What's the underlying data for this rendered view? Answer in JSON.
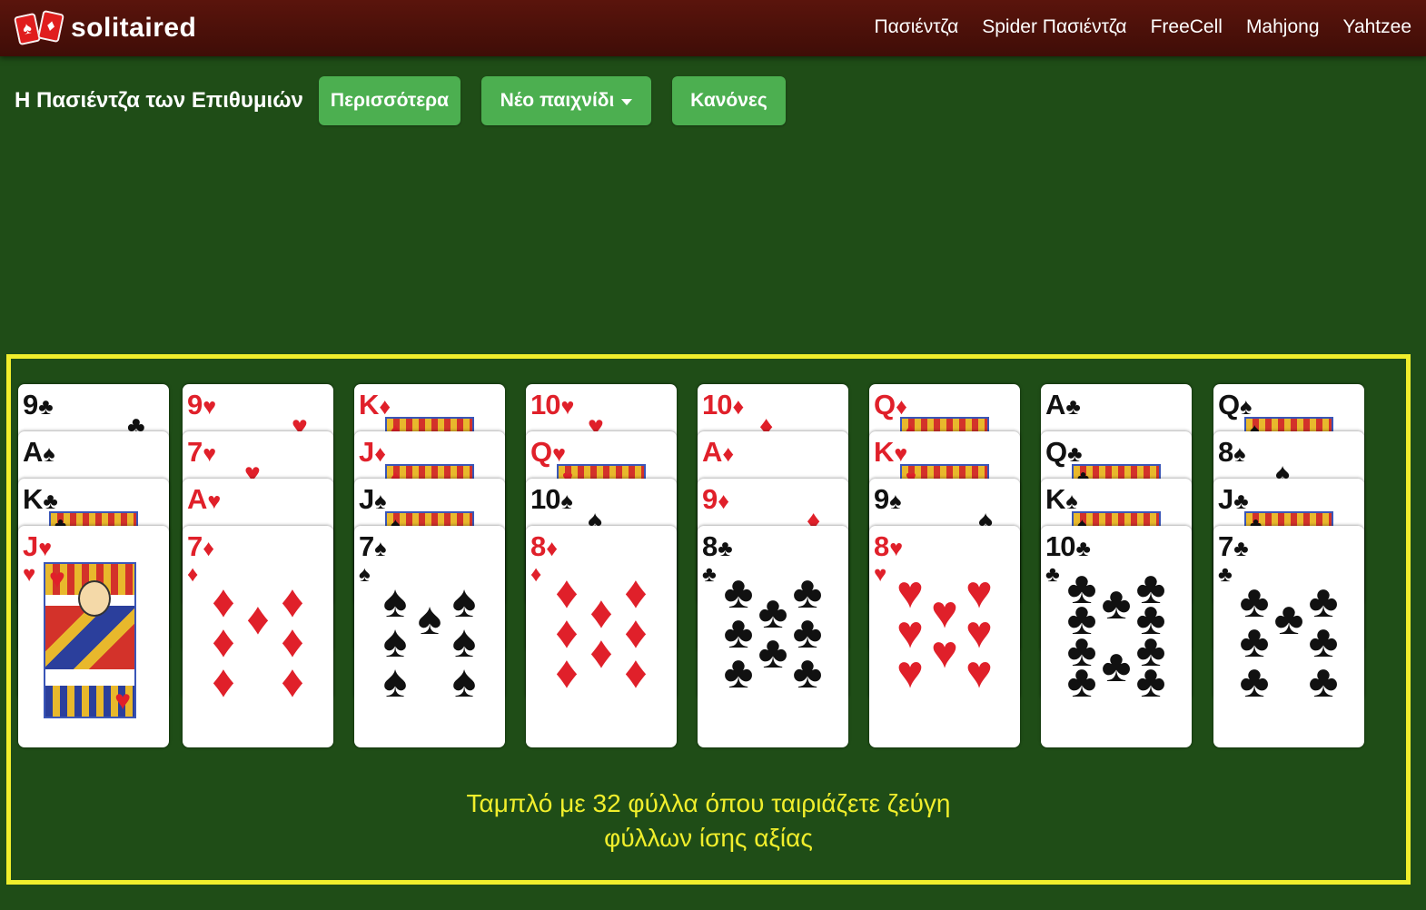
{
  "brand": {
    "name": "solitaired"
  },
  "nav": [
    {
      "label": "Πασιέντζα"
    },
    {
      "label": "Spider Πασιέντζα"
    },
    {
      "label": "FreeCell"
    },
    {
      "label": "Mahjong"
    },
    {
      "label": "Yahtzee"
    }
  ],
  "page": {
    "title": "Η Πασιέντζα των Επιθυμιών"
  },
  "toolbar": {
    "more_label": "Περισσότερα",
    "new_game_label": "Νέο παιχνίδι",
    "rules_label": "Κανόνες"
  },
  "colors": {
    "felt": "#1f4d17",
    "topbar": "#4a100a",
    "button": "#4caf50",
    "highlight": "#f0ee2c",
    "red_suit": "#e0202a"
  },
  "tableau": [
    {
      "cards": [
        {
          "rank": "9",
          "suit": "♣"
        },
        {
          "rank": "A",
          "suit": "♠"
        },
        {
          "rank": "K",
          "suit": "♣"
        },
        {
          "rank": "J",
          "suit": "♥"
        }
      ]
    },
    {
      "cards": [
        {
          "rank": "9",
          "suit": "♥"
        },
        {
          "rank": "7",
          "suit": "♥"
        },
        {
          "rank": "A",
          "suit": "♥"
        },
        {
          "rank": "7",
          "suit": "♦"
        }
      ]
    },
    {
      "cards": [
        {
          "rank": "K",
          "suit": "♦"
        },
        {
          "rank": "J",
          "suit": "♦"
        },
        {
          "rank": "J",
          "suit": "♠"
        },
        {
          "rank": "7",
          "suit": "♠"
        }
      ]
    },
    {
      "cards": [
        {
          "rank": "10",
          "suit": "♥"
        },
        {
          "rank": "Q",
          "suit": "♥"
        },
        {
          "rank": "10",
          "suit": "♠"
        },
        {
          "rank": "8",
          "suit": "♦"
        }
      ]
    },
    {
      "cards": [
        {
          "rank": "10",
          "suit": "♦"
        },
        {
          "rank": "A",
          "suit": "♦"
        },
        {
          "rank": "9",
          "suit": "♦"
        },
        {
          "rank": "8",
          "suit": "♣"
        }
      ]
    },
    {
      "cards": [
        {
          "rank": "Q",
          "suit": "♦"
        },
        {
          "rank": "K",
          "suit": "♥"
        },
        {
          "rank": "9",
          "suit": "♠"
        },
        {
          "rank": "8",
          "suit": "♥"
        }
      ]
    },
    {
      "cards": [
        {
          "rank": "A",
          "suit": "♣"
        },
        {
          "rank": "Q",
          "suit": "♣"
        },
        {
          "rank": "K",
          "suit": "♠"
        },
        {
          "rank": "10",
          "suit": "♣"
        }
      ]
    },
    {
      "cards": [
        {
          "rank": "Q",
          "suit": "♠"
        },
        {
          "rank": "8",
          "suit": "♠"
        },
        {
          "rank": "J",
          "suit": "♣"
        },
        {
          "rank": "7",
          "suit": "♣"
        }
      ]
    }
  ],
  "message": {
    "line1": "Ταμπλό με 32 φύλλα όπου ταιριάζετε ζεύγη",
    "line2": "φύλλων ίσης αξίας"
  }
}
